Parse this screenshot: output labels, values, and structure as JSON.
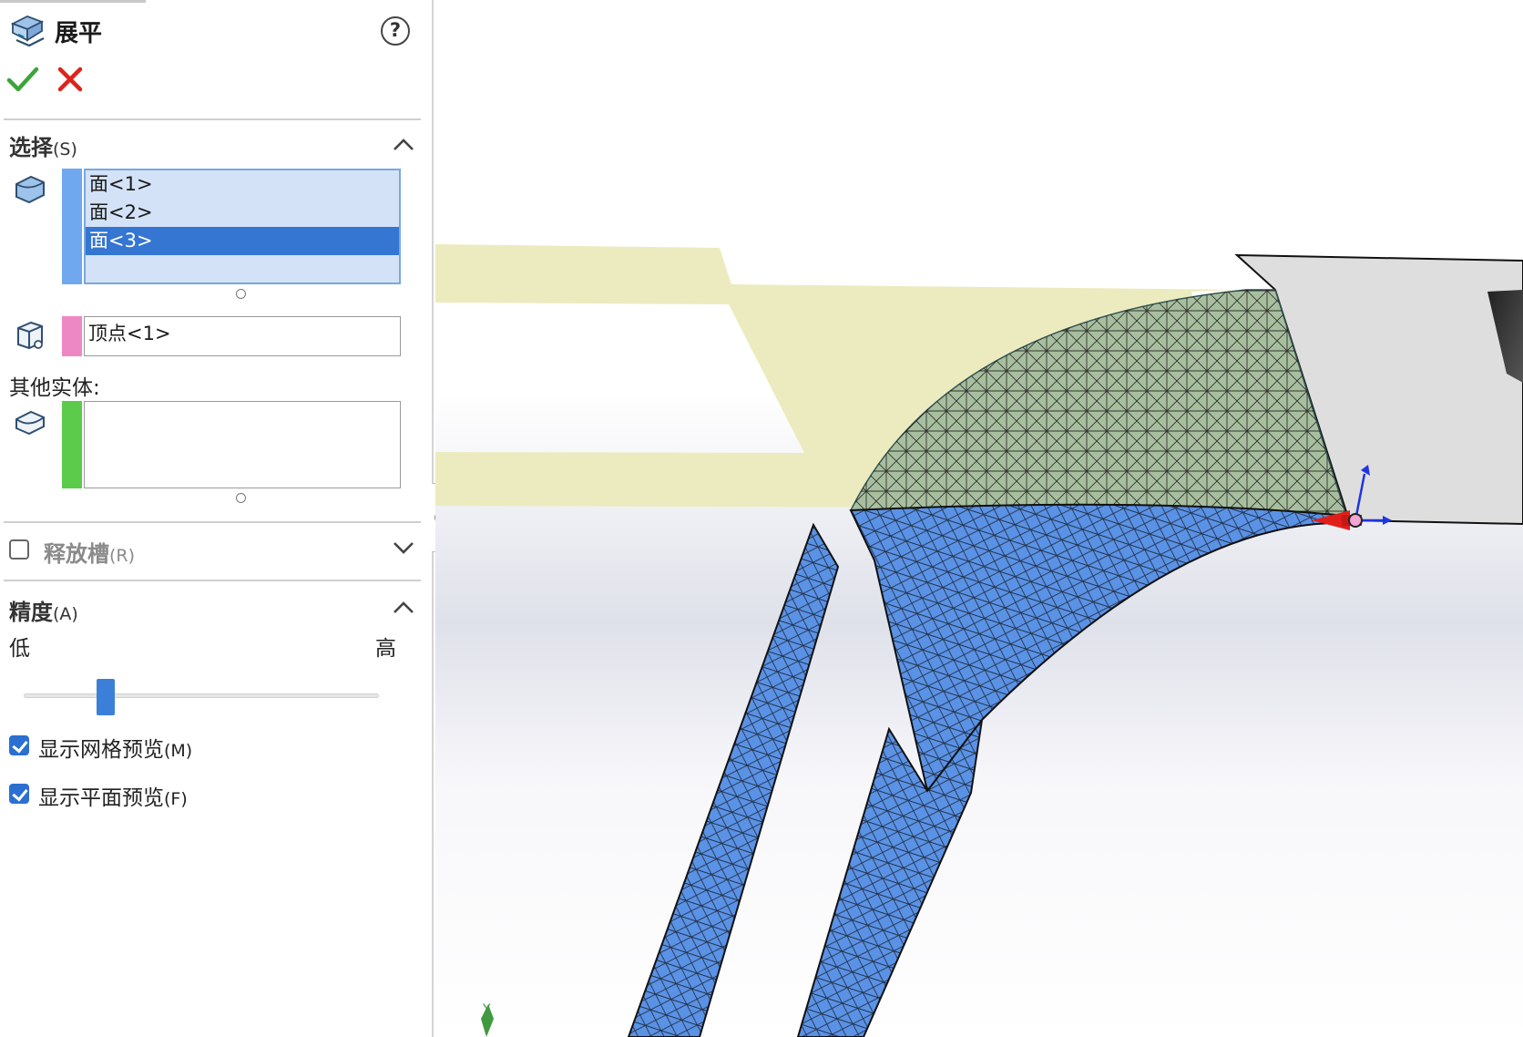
{
  "feature": {
    "title": "展平",
    "ok_icon": "check-icon",
    "cancel_icon": "close-icon",
    "help_icon": "help-icon",
    "help_glyph": "?"
  },
  "selection": {
    "title": "选择",
    "hotkey": "(S)",
    "faces": [
      "面<1>",
      "面<2>",
      "面<3>"
    ],
    "selected_index": 2,
    "vertex": "顶点<1>",
    "other_bodies_label": "其他实体:",
    "faces_color": "#6fa8ee",
    "vertex_color": "#ee88c4",
    "bodies_color": "#5ccb4c"
  },
  "relief": {
    "title": "释放槽",
    "hotkey": "(R)",
    "checked": false
  },
  "accuracy": {
    "title": "精度",
    "hotkey": "(A)",
    "low_label": "低",
    "high_label": "高",
    "slider_value": 0.23,
    "show_mesh_preview": {
      "label": "显示网格预览",
      "hotkey": "(M)",
      "checked": true
    },
    "show_flat_preview": {
      "label": "显示平面预览",
      "hotkey": "(F)",
      "checked": true
    }
  },
  "viewport": {
    "triad_label": "Y",
    "mesh_color": "#5a92e6",
    "preview_color": "#ecebbf",
    "body_color": "#dedede"
  }
}
